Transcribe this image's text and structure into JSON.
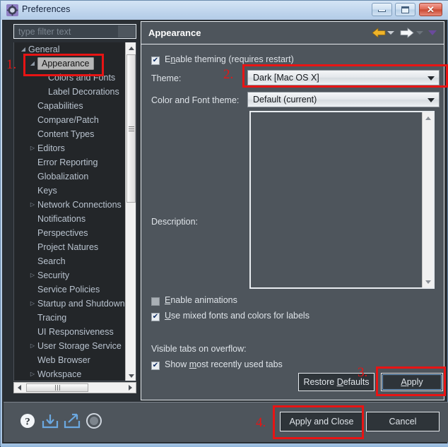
{
  "window": {
    "title": "Preferences",
    "icon": "preferences-gear-icon",
    "minimize_label": "Minimize",
    "maximize_label": "Maximize",
    "close_label": "Close"
  },
  "sidebar": {
    "filter": {
      "placeholder": "type filter text",
      "value": ""
    },
    "tree": [
      {
        "label": "General",
        "level": 1,
        "expandable": true,
        "selected": false
      },
      {
        "label": "Appearance",
        "level": 2,
        "expandable": true,
        "selected": true
      },
      {
        "label": "Colors and Fonts",
        "level": 3,
        "expandable": false,
        "selected": false
      },
      {
        "label": "Label Decorations",
        "level": 3,
        "expandable": false,
        "selected": false
      },
      {
        "label": "Capabilities",
        "level": 2,
        "expandable": false,
        "selected": false
      },
      {
        "label": "Compare/Patch",
        "level": 2,
        "expandable": false,
        "selected": false
      },
      {
        "label": "Content Types",
        "level": 2,
        "expandable": false,
        "selected": false
      },
      {
        "label": "Editors",
        "level": 2,
        "expandable": true,
        "selected": false
      },
      {
        "label": "Error Reporting",
        "level": 2,
        "expandable": false,
        "selected": false
      },
      {
        "label": "Globalization",
        "level": 2,
        "expandable": false,
        "selected": false
      },
      {
        "label": "Keys",
        "level": 2,
        "expandable": false,
        "selected": false
      },
      {
        "label": "Network Connections",
        "level": 2,
        "expandable": true,
        "selected": false
      },
      {
        "label": "Notifications",
        "level": 2,
        "expandable": false,
        "selected": false
      },
      {
        "label": "Perspectives",
        "level": 2,
        "expandable": false,
        "selected": false
      },
      {
        "label": "Project Natures",
        "level": 2,
        "expandable": false,
        "selected": false
      },
      {
        "label": "Search",
        "level": 2,
        "expandable": false,
        "selected": false
      },
      {
        "label": "Security",
        "level": 2,
        "expandable": true,
        "selected": false
      },
      {
        "label": "Service Policies",
        "level": 2,
        "expandable": false,
        "selected": false
      },
      {
        "label": "Startup and Shutdown",
        "level": 2,
        "expandable": true,
        "selected": false
      },
      {
        "label": "Tracing",
        "level": 2,
        "expandable": false,
        "selected": false
      },
      {
        "label": "UI Responsiveness",
        "level": 2,
        "expandable": false,
        "selected": false
      },
      {
        "label": "User Storage Service",
        "level": 2,
        "expandable": true,
        "selected": false
      },
      {
        "label": "Web Browser",
        "level": 2,
        "expandable": false,
        "selected": false
      },
      {
        "label": "Workspace",
        "level": 2,
        "expandable": true,
        "selected": false
      }
    ]
  },
  "panel": {
    "title": "Appearance",
    "nav": {
      "back_icon": "arrow-left-icon",
      "back_menu_icon": "chevron-down-icon",
      "forward_icon": "arrow-right-icon",
      "forward_menu_icon": "chevron-down-icon",
      "view_menu_icon": "view-menu-icon"
    },
    "enable_theming": {
      "label": "Enable theming (requires restart)",
      "checked": true
    },
    "theme": {
      "label": "Theme:",
      "value": "Dark [Mac OS X]",
      "options": [
        "Dark [Mac OS X]"
      ]
    },
    "color_font_theme": {
      "label": "Color and Font theme:",
      "value": "Default (current)",
      "options": [
        "Default (current)"
      ]
    },
    "description": {
      "label": "Description:",
      "value": ""
    },
    "enable_animations": {
      "label": "Enable animations",
      "checked": false,
      "enabled": false
    },
    "mixed_fonts": {
      "label": "Use mixed fonts and colors for labels",
      "checked": true
    },
    "visible_tabs_label": "Visible tabs on overflow:",
    "show_mru_tabs": {
      "label": "Show most recently used tabs",
      "checked": true
    },
    "restore_defaults_label": "Restore Defaults",
    "apply_label": "Apply"
  },
  "footer": {
    "help_icon": "help-question-icon",
    "import_icon": "import-icon",
    "export_icon": "export-icon",
    "settings_icon": "settings-gear-icon",
    "apply_and_close_label": "Apply and Close",
    "cancel_label": "Cancel"
  },
  "annotations": {
    "color": "#e81414",
    "steps": [
      {
        "id": "1",
        "label": "1.",
        "target": "sidebar-item-appearance"
      },
      {
        "id": "2",
        "label": "2.",
        "target": "theme-combo"
      },
      {
        "id": "3",
        "label": "3.",
        "target": "apply-button"
      },
      {
        "id": "4",
        "label": "4.",
        "target": "apply-and-close-button"
      }
    ]
  }
}
